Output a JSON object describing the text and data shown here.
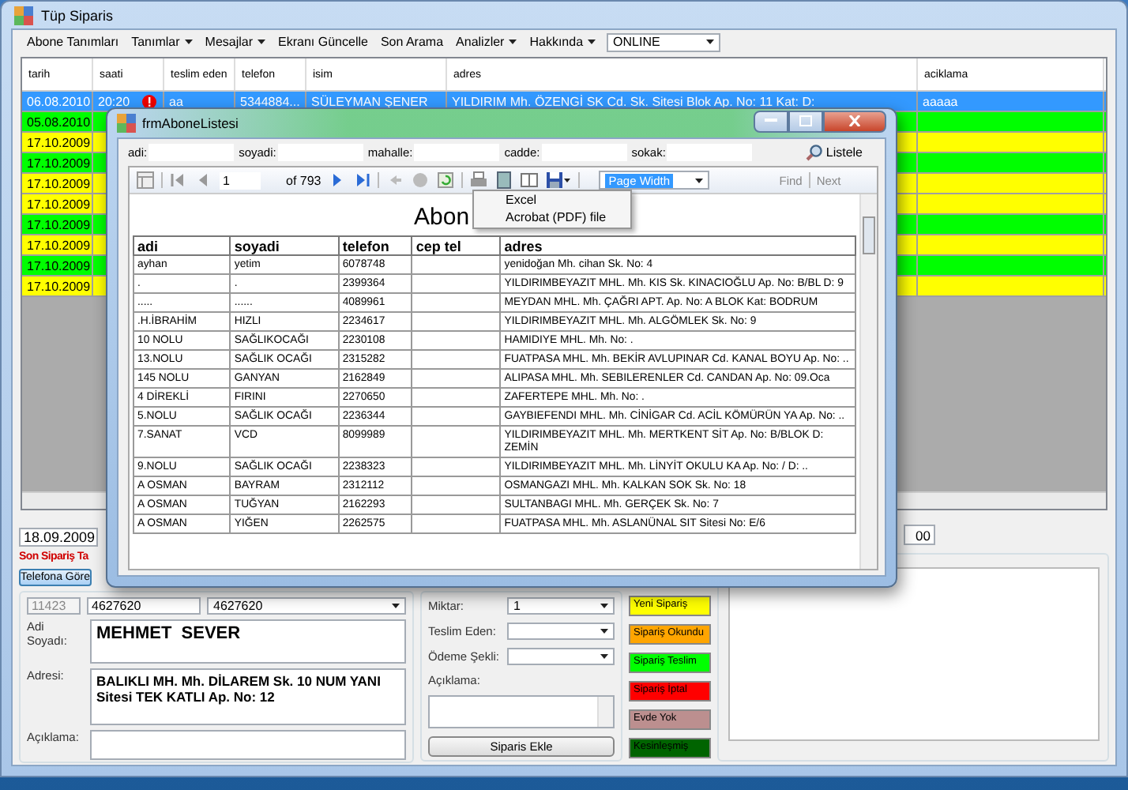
{
  "window": {
    "title": "Tüp Siparis"
  },
  "menu": [
    {
      "label": "Abone Tanımları",
      "dropdown": false
    },
    {
      "label": "Tanımlar",
      "dropdown": true
    },
    {
      "label": "Mesajlar",
      "dropdown": true
    },
    {
      "label": "Ekranı Güncelle",
      "dropdown": false
    },
    {
      "label": "Son Arama",
      "dropdown": false
    },
    {
      "label": "Analizler",
      "dropdown": true
    },
    {
      "label": "Hakkında",
      "dropdown": true
    }
  ],
  "mode_combo": {
    "value": "ONLINE"
  },
  "orders": {
    "columns": [
      "tarih",
      "saati",
      "teslim eden",
      "telefon",
      "isim",
      "adres",
      "aciklama"
    ],
    "rows": [
      {
        "selected": true,
        "alert": true,
        "cells": [
          "06.08.2010",
          "20:20",
          "aa",
          "5344884...",
          "SÜLEYMAN ŞENER",
          "YILDIRIM Mh. ÖZENGİ SK Cd.  Sk.  Sitesi  Blok  Ap. No: 11 Kat:  D:",
          "aaaaa"
        ]
      },
      {
        "selected": false,
        "color": "#00ff00",
        "cells": [
          "05.08.2010"
        ]
      },
      {
        "selected": false,
        "color": "#ffff00",
        "cells": [
          "17.10.2009"
        ]
      },
      {
        "selected": false,
        "color": "#00ff00",
        "cells": [
          "17.10.2009"
        ]
      },
      {
        "selected": false,
        "color": "#ffff00",
        "cells": [
          "17.10.2009"
        ]
      },
      {
        "selected": false,
        "color": "#ffff00",
        "cells": [
          "17.10.2009"
        ]
      },
      {
        "selected": false,
        "color": "#00ff00",
        "cells": [
          "17.10.2009"
        ]
      },
      {
        "selected": false,
        "color": "#ffff00",
        "cells": [
          "17.10.2009"
        ]
      },
      {
        "selected": false,
        "color": "#00ff00",
        "cells": [
          "17.10.2009"
        ]
      },
      {
        "selected": false,
        "color": "#ffff00",
        "cells": [
          "17.10.2009"
        ]
      }
    ]
  },
  "customer": {
    "date": "18.09.2009",
    "last_order": "Son Sipariş Ta",
    "search_button": "Telefona Göre",
    "id": "11423",
    "phone": "4627620",
    "phone_combo": "4627620",
    "name_label": "Adi Soyadı:",
    "name": "MEHMET  SEVER",
    "address_label": "Adresi:",
    "address": "BALIKLI MH. Mh. DİLAREM Sk. 10 NUM YANI Sitesi TEK KATLI Ap. No: 12",
    "note_label": "Açıklama:"
  },
  "total_field": "00",
  "order_form": {
    "quantity_label": "Miktar:",
    "quantity": "1",
    "courier_label": "Teslim Eden:",
    "payment_label": "Ödeme Şekli:",
    "note_label": "Açıklama:",
    "submit": "Siparis Ekle"
  },
  "legend": [
    {
      "label": "Yeni Sipariş",
      "color": "#ffff00"
    },
    {
      "label": "Sipariş Okundu",
      "color": "#ffa500"
    },
    {
      "label": "Sipariş Teslim",
      "color": "#00ff00"
    },
    {
      "label": "Sipariş İptal",
      "color": "#ff0000"
    },
    {
      "label": "Evde Yok",
      "color": "#bc8f8f"
    },
    {
      "label": "Kesinleşmiş",
      "color": "#006400"
    }
  ],
  "dialog": {
    "title": "frmAboneListesi",
    "filters": [
      "adi:",
      "soyadi:",
      "mahalle:",
      "cadde:",
      "sokak:"
    ],
    "list_button": "Listele",
    "toolbar": {
      "page": "1",
      "total": "of 793",
      "zoom": "Page Width",
      "find": "Find",
      "next": "Next"
    },
    "export_menu": [
      "Excel",
      "Acrobat (PDF) file"
    ],
    "report": {
      "title": "Abon",
      "columns": [
        "adi",
        "soyadi",
        "telefon",
        "cep tel",
        "adres"
      ],
      "rows": [
        [
          "ayhan",
          "yetim",
          "6078748",
          "",
          "yenidoğan Mh. cihan Sk. No: 4"
        ],
        [
          ".",
          ".",
          "2399364",
          "",
          "YILDIRIMBEYAZIT MHL. Mh. KIS Sk. KINACIOĞLU Ap. No: B/BL D: 9"
        ],
        [
          ".....",
          "......",
          "4089961",
          "",
          "MEYDAN MHL. Mh. ÇAĞRI APT. Ap. No: A BLOK Kat: BODRUM"
        ],
        [
          ".H.İBRAHİM",
          "HIZLI",
          "2234617",
          "",
          "YILDIRIMBEYAZIT MHL. Mh. ALGÖMLEK Sk. No: 9"
        ],
        [
          "10 NOLU",
          "SAĞLIKOCAĞI",
          "2230108",
          "",
          "HAMIDIYE MHL. Mh. No: ."
        ],
        [
          "13.NOLU",
          "SAĞLIK OCAĞI",
          "2315282",
          "",
          "FUATPASA MHL. Mh. BEKİR AVLUPINAR Cd. KANAL BOYU Ap. No: .."
        ],
        [
          "145 NOLU",
          "GANYAN",
          "2162849",
          "",
          "ALIPASA MHL. Mh. SEBILERENLER Cd. CANDAN Ap. No: 09.Oca"
        ],
        [
          "4 DİREKLİ",
          "FIRINI",
          "2270650",
          "",
          "ZAFERTEPE MHL. Mh. No: ."
        ],
        [
          "5.NOLU",
          "SAĞLIK OCAĞI",
          "2236344",
          "",
          "GAYBIEFENDI MHL. Mh. CİNİGAR Cd. ACİL KÖMÜRÜN YA Ap. No: .."
        ],
        [
          "7.SANAT",
          "VCD",
          "8099989",
          "",
          "YILDIRIMBEYAZIT MHL. Mh. MERTKENT SİT Ap. No: B/BLOK D: ZEMİN"
        ],
        [
          "9.NOLU",
          "SAĞLIK OCAĞI",
          "2238323",
          "",
          "YILDIRIMBEYAZIT MHL. Mh. LİNYİT OKULU KA Ap. No: / D: .."
        ],
        [
          "A OSMAN",
          "BAYRAM",
          "2312112",
          "",
          "OSMANGAZI MHL. Mh. KALKAN SOK Sk. No: 18"
        ],
        [
          "A OSMAN",
          "TUĞYAN",
          "2162293",
          "",
          "SULTANBAGI MHL. Mh. GERÇEK Sk. No: 7"
        ],
        [
          "A OSMAN",
          "YIĞEN",
          "2262575",
          "",
          "FUATPASA MHL. Mh. ASLANÜNAL SIT Sitesi No: E/6"
        ]
      ]
    }
  }
}
